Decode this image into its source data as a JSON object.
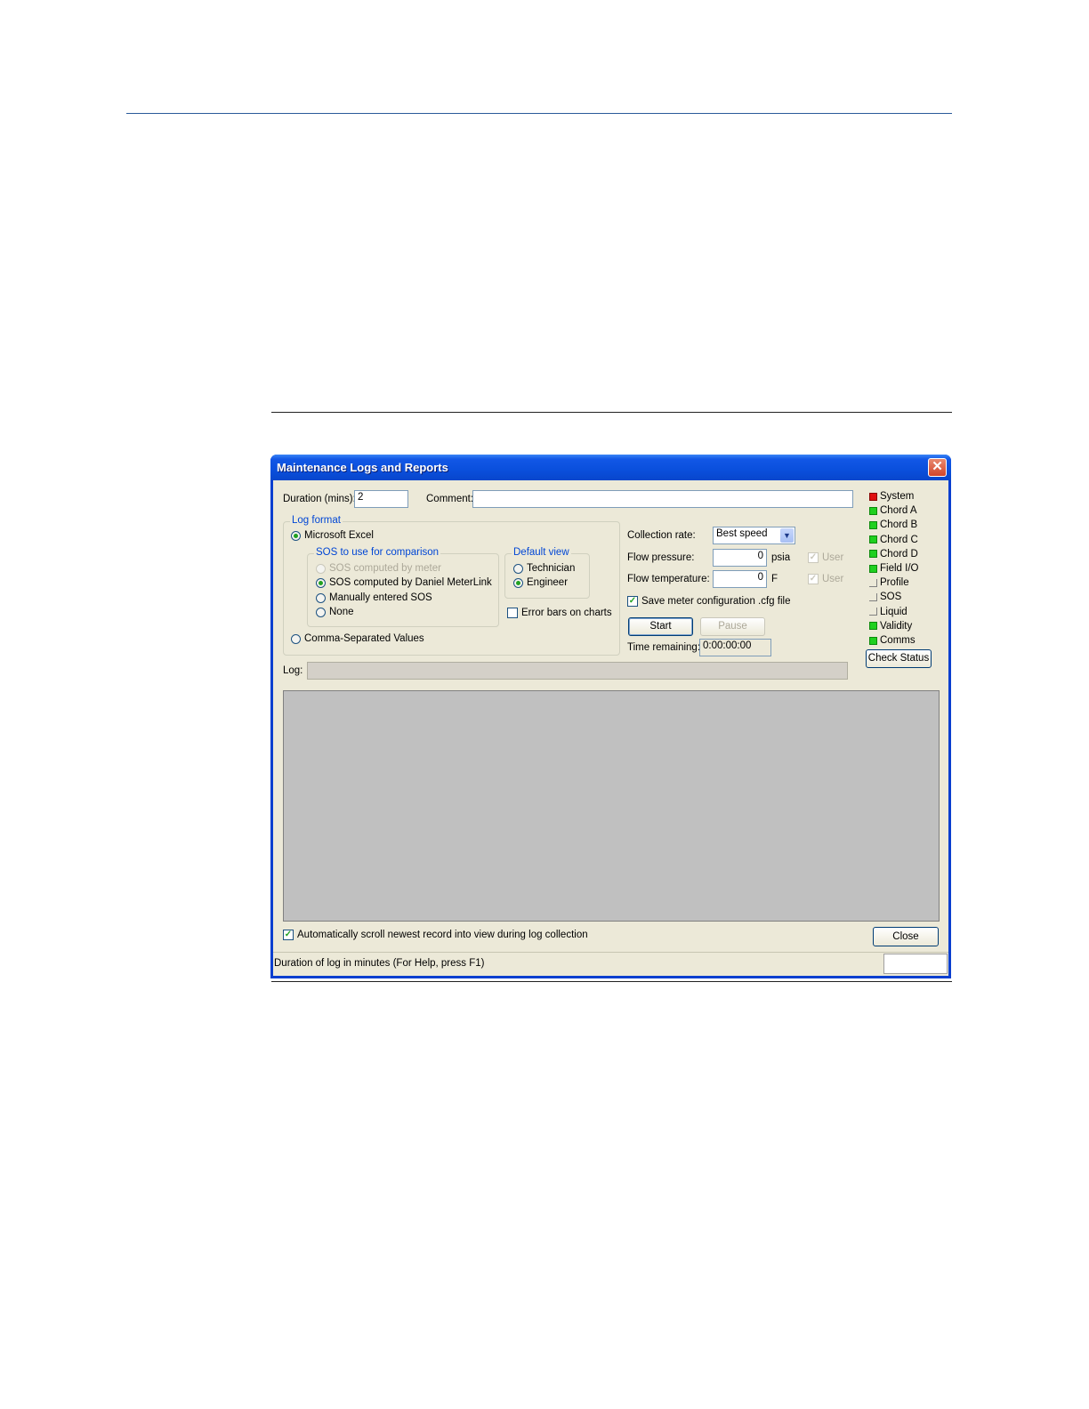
{
  "window": {
    "title": "Maintenance Logs and Reports",
    "close_glyph": "✕"
  },
  "duration": {
    "label": "Duration (mins):",
    "value": "2"
  },
  "comment": {
    "label": "Comment:",
    "value": ""
  },
  "log_format": {
    "legend": "Log format",
    "excel_label": "Microsoft Excel",
    "csv_label": "Comma-Separated Values",
    "selected": "Microsoft Excel"
  },
  "sos_group": {
    "legend": "SOS to use for comparison",
    "options": [
      "SOS computed by meter",
      "SOS computed by Daniel MeterLink",
      "Manually entered SOS",
      "None"
    ],
    "selected": "SOS computed by Daniel MeterLink"
  },
  "default_view": {
    "legend": "Default view",
    "options": [
      "Technician",
      "Engineer"
    ],
    "selected": "Engineer"
  },
  "error_bars": {
    "label": "Error bars on charts",
    "checked": false
  },
  "collection_rate": {
    "label": "Collection rate:",
    "value": "Best speed"
  },
  "flow_pressure": {
    "label": "Flow pressure:",
    "value": "0",
    "unit": "psia",
    "user_label": "User"
  },
  "flow_temperature": {
    "label": "Flow temperature:",
    "value": "0",
    "unit": "F",
    "user_label": "User"
  },
  "save_cfg": {
    "label": "Save meter configuration .cfg file",
    "checked": true
  },
  "buttons": {
    "start": "Start",
    "pause": "Pause",
    "check_status": "Check Status",
    "close": "Close"
  },
  "time_remaining": {
    "label": "Time remaining:",
    "value": "0:00:00:00"
  },
  "log": {
    "label": "Log:",
    "value": ""
  },
  "status_indicators": [
    {
      "label": "System",
      "state": "red"
    },
    {
      "label": "Chord A",
      "state": "green"
    },
    {
      "label": "Chord B",
      "state": "green"
    },
    {
      "label": "Chord C",
      "state": "green"
    },
    {
      "label": "Chord D",
      "state": "green"
    },
    {
      "label": "Field I/O",
      "state": "green"
    },
    {
      "label": "Profile",
      "state": "off"
    },
    {
      "label": "SOS",
      "state": "off"
    },
    {
      "label": "Liquid",
      "state": "off"
    },
    {
      "label": "Validity",
      "state": "green"
    },
    {
      "label": "Comms",
      "state": "green"
    }
  ],
  "autoscroll": {
    "label": "Automatically scroll newest record into view during log collection",
    "checked": true
  },
  "statusbar": {
    "text": "Duration of log in minutes (For Help, press F1)"
  },
  "check_glyph": "✓",
  "combo_glyph": "▼"
}
